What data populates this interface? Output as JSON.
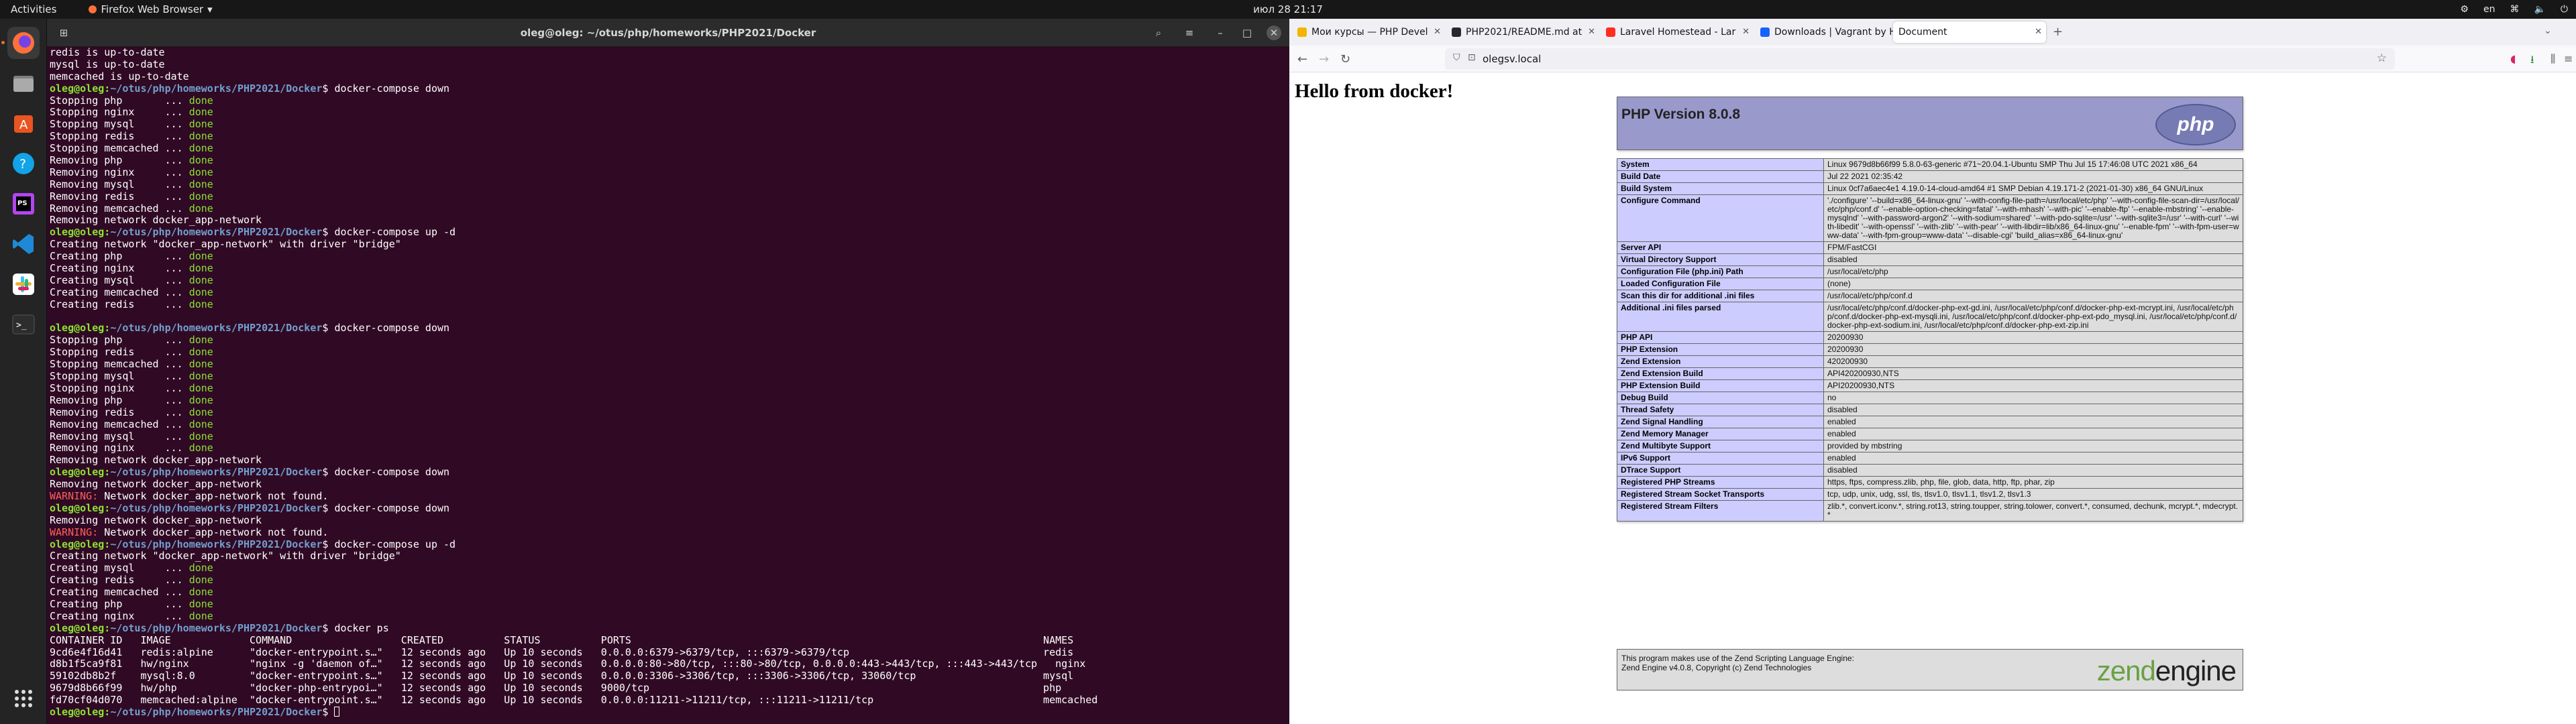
{
  "topbar": {
    "activities": "Activities",
    "app_name": "Firefox Web Browser",
    "clock": "июл 28  21:17",
    "lang": "en"
  },
  "dock": {
    "apps": [
      {
        "name": "firefox-icon",
        "color": "#ff7139",
        "active": true
      },
      {
        "name": "files-icon",
        "color": "#5e5e5e"
      },
      {
        "name": "software-icon",
        "color": "#e95420"
      },
      {
        "name": "help-icon",
        "color": "#12a3e8"
      },
      {
        "name": "phpstorm-icon",
        "color": "#b345f1"
      },
      {
        "name": "vscode-icon",
        "color": "#1e8ad6"
      },
      {
        "name": "slack-icon",
        "color": "#ffffff"
      },
      {
        "name": "terminal-icon",
        "color": "#2d2d2d"
      }
    ],
    "show_apps": "show-applications-icon"
  },
  "terminal": {
    "title": "oleg@oleg: ~/otus/php/homeworks/PHP2021/Docker",
    "prompt_user": "oleg@oleg",
    "prompt_path": "~/otus/php/homeworks/PHP2021/Docker",
    "lines": [
      {
        "t": "plain",
        "text": "redis is up-to-date"
      },
      {
        "t": "plain",
        "text": "mysql is up-to-date"
      },
      {
        "t": "plain",
        "text": "memcached is up-to-date"
      },
      {
        "t": "cmd",
        "text": "docker-compose down"
      },
      {
        "t": "status",
        "text": "Stopping php       ... ",
        "s": "done"
      },
      {
        "t": "status",
        "text": "Stopping nginx     ... ",
        "s": "done"
      },
      {
        "t": "status",
        "text": "Stopping mysql     ... ",
        "s": "done"
      },
      {
        "t": "status",
        "text": "Stopping redis     ... ",
        "s": "done"
      },
      {
        "t": "status",
        "text": "Stopping memcached ... ",
        "s": "done"
      },
      {
        "t": "status",
        "text": "Removing php       ... ",
        "s": "done"
      },
      {
        "t": "status",
        "text": "Removing nginx     ... ",
        "s": "done"
      },
      {
        "t": "status",
        "text": "Removing mysql     ... ",
        "s": "done"
      },
      {
        "t": "status",
        "text": "Removing redis     ... ",
        "s": "done"
      },
      {
        "t": "status",
        "text": "Removing memcached ... ",
        "s": "done"
      },
      {
        "t": "plain",
        "text": "Removing network docker_app-network"
      },
      {
        "t": "cmd",
        "text": "docker-compose up -d"
      },
      {
        "t": "plain",
        "text": "Creating network \"docker_app-network\" with driver \"bridge\""
      },
      {
        "t": "status",
        "text": "Creating php       ... ",
        "s": "done"
      },
      {
        "t": "status",
        "text": "Creating nginx     ... ",
        "s": "done"
      },
      {
        "t": "status",
        "text": "Creating mysql     ... ",
        "s": "done"
      },
      {
        "t": "status",
        "text": "Creating memcached ... ",
        "s": "done"
      },
      {
        "t": "status",
        "text": "Creating redis     ... ",
        "s": "done"
      },
      {
        "t": "blank",
        "text": ""
      },
      {
        "t": "cmd",
        "text": "docker-compose down"
      },
      {
        "t": "status",
        "text": "Stopping php       ... ",
        "s": "done"
      },
      {
        "t": "status",
        "text": "Stopping redis     ... ",
        "s": "done"
      },
      {
        "t": "status",
        "text": "Stopping memcached ... ",
        "s": "done"
      },
      {
        "t": "status",
        "text": "Stopping mysql     ... ",
        "s": "done"
      },
      {
        "t": "status",
        "text": "Stopping nginx     ... ",
        "s": "done"
      },
      {
        "t": "status",
        "text": "Removing php       ... ",
        "s": "done"
      },
      {
        "t": "status",
        "text": "Removing redis     ... ",
        "s": "done"
      },
      {
        "t": "status",
        "text": "Removing memcached ... ",
        "s": "done"
      },
      {
        "t": "status",
        "text": "Removing mysql     ... ",
        "s": "done"
      },
      {
        "t": "status",
        "text": "Removing nginx     ... ",
        "s": "done"
      },
      {
        "t": "plain",
        "text": "Removing network docker_app-network"
      },
      {
        "t": "cmd",
        "text": "docker-compose down"
      },
      {
        "t": "plain",
        "text": "Removing network docker_app-network"
      },
      {
        "t": "warn",
        "w": "WARNING:",
        "text": " Network docker_app-network not found."
      },
      {
        "t": "cmd",
        "text": "docker-compose down"
      },
      {
        "t": "plain",
        "text": "Removing network docker_app-network"
      },
      {
        "t": "warn",
        "w": "WARNING:",
        "text": " Network docker_app-network not found."
      },
      {
        "t": "cmd",
        "text": "docker-compose up -d"
      },
      {
        "t": "plain",
        "text": "Creating network \"docker_app-network\" with driver \"bridge\""
      },
      {
        "t": "status",
        "text": "Creating mysql     ... ",
        "s": "done"
      },
      {
        "t": "status",
        "text": "Creating redis     ... ",
        "s": "done"
      },
      {
        "t": "status",
        "text": "Creating memcached ... ",
        "s": "done"
      },
      {
        "t": "status",
        "text": "Creating php       ... ",
        "s": "done"
      },
      {
        "t": "status",
        "text": "Creating nginx     ... ",
        "s": "done"
      },
      {
        "t": "cmd",
        "text": "docker ps"
      },
      {
        "t": "plain",
        "text": "CONTAINER ID   IMAGE             COMMAND                  CREATED          STATUS          PORTS                                                                    NAMES"
      },
      {
        "t": "plain",
        "text": "9cd6e4f16d41   redis:alpine      \"docker-entrypoint.s…\"   12 seconds ago   Up 10 seconds   0.0.0.0:6379->6379/tcp, :::6379->6379/tcp                                redis"
      },
      {
        "t": "plain",
        "text": "d8b1f5ca9f81   hw/nginx          \"nginx -g 'daemon of…\"   12 seconds ago   Up 10 seconds   0.0.0.0:80->80/tcp, :::80->80/tcp, 0.0.0.0:443->443/tcp, :::443->443/tcp   nginx"
      },
      {
        "t": "plain",
        "text": "59102db8b2f    mysql:8.0         \"docker-entrypoint.s…\"   12 seconds ago   Up 10 seconds   0.0.0.0:3306->3306/tcp, :::3306->3306/tcp, 33060/tcp                     mysql"
      },
      {
        "t": "plain",
        "text": "9679d8b66f99   hw/php            \"docker-php-entrypoi…\"   12 seconds ago   Up 10 seconds   9000/tcp                                                                 php"
      },
      {
        "t": "plain",
        "text": "fd70cf04d070   memcached:alpine  \"docker-entrypoint.s…\"   12 seconds ago   Up 10 seconds   0.0.0.0:11211->11211/tcp, :::11211->11211/tcp                            memcached"
      },
      {
        "t": "cmdcur",
        "text": ""
      }
    ]
  },
  "browser": {
    "tabs": [
      {
        "label": "Мои курсы — PHP Devel",
        "color": "#f4b400"
      },
      {
        "label": "PHP2021/README.md at",
        "color": "#24292e"
      },
      {
        "label": "Laravel Homestead - Lar",
        "color": "#ff2d20"
      },
      {
        "label": "Downloads | Vagrant by H",
        "color": "#1563ff"
      },
      {
        "label": "Document",
        "color": "#dddddd",
        "active": true
      }
    ],
    "url": "olegsv.local",
    "page": {
      "heading": "Hello from docker!",
      "php_title": "PHP Version 8.0.8",
      "php_logo": "php",
      "rows": [
        [
          "System",
          "Linux 9679d8b66f99 5.8.0-63-generic #71~20.04.1-Ubuntu SMP Thu Jul 15 17:46:08 UTC 2021 x86_64"
        ],
        [
          "Build Date",
          "Jul 22 2021 02:35:42"
        ],
        [
          "Build System",
          "Linux 0cf7a6aec4e1 4.19.0-14-cloud-amd64 #1 SMP Debian 4.19.171-2 (2021-01-30) x86_64 GNU/Linux"
        ],
        [
          "Configure Command",
          "'./configure' '--build=x86_64-linux-gnu' '--with-config-file-path=/usr/local/etc/php' '--with-config-file-scan-dir=/usr/local/etc/php/conf.d' '--enable-option-checking=fatal' '--with-mhash' '--with-pic' '--enable-ftp' '--enable-mbstring' '--enable-mysqlnd' '--with-password-argon2' '--with-sodium=shared' '--with-pdo-sqlite=/usr' '--with-sqlite3=/usr' '--with-curl' '--with-libedit' '--with-openssl' '--with-zlib' '--with-pear' '--with-libdir=lib/x86_64-linux-gnu' '--enable-fpm' '--with-fpm-user=www-data' '--with-fpm-group=www-data' '--disable-cgi' 'build_alias=x86_64-linux-gnu'"
        ],
        [
          "Server API",
          "FPM/FastCGI"
        ],
        [
          "Virtual Directory Support",
          "disabled"
        ],
        [
          "Configuration File (php.ini) Path",
          "/usr/local/etc/php"
        ],
        [
          "Loaded Configuration File",
          "(none)"
        ],
        [
          "Scan this dir for additional .ini files",
          "/usr/local/etc/php/conf.d"
        ],
        [
          "Additional .ini files parsed",
          "/usr/local/etc/php/conf.d/docker-php-ext-gd.ini, /usr/local/etc/php/conf.d/docker-php-ext-mcrypt.ini, /usr/local/etc/php/conf.d/docker-php-ext-mysqli.ini, /usr/local/etc/php/conf.d/docker-php-ext-pdo_mysql.ini, /usr/local/etc/php/conf.d/docker-php-ext-sodium.ini, /usr/local/etc/php/conf.d/docker-php-ext-zip.ini"
        ],
        [
          "PHP API",
          "20200930"
        ],
        [
          "PHP Extension",
          "20200930"
        ],
        [
          "Zend Extension",
          "420200930"
        ],
        [
          "Zend Extension Build",
          "API420200930,NTS"
        ],
        [
          "PHP Extension Build",
          "API20200930,NTS"
        ],
        [
          "Debug Build",
          "no"
        ],
        [
          "Thread Safety",
          "disabled"
        ],
        [
          "Zend Signal Handling",
          "enabled"
        ],
        [
          "Zend Memory Manager",
          "enabled"
        ],
        [
          "Zend Multibyte Support",
          "provided by mbstring"
        ],
        [
          "IPv6 Support",
          "enabled"
        ],
        [
          "DTrace Support",
          "disabled"
        ],
        [
          "Registered PHP Streams",
          "https, ftps, compress.zlib, php, file, glob, data, http, ftp, phar, zip"
        ],
        [
          "Registered Stream Socket Transports",
          "tcp, udp, unix, udg, ssl, tls, tlsv1.0, tlsv1.1, tlsv1.2, tlsv1.3"
        ],
        [
          "Registered Stream Filters",
          "zlib.*, convert.iconv.*, string.rot13, string.toupper, string.tolower, convert.*, consumed, dechunk, mcrypt.*, mdecrypt.*"
        ]
      ],
      "zend_line1": "This program makes use of the Zend Scripting Language Engine:",
      "zend_line2": "Zend Engine v4.0.8, Copyright (c) Zend Technologies",
      "zend_logo_a": "zend",
      "zend_logo_b": "engine"
    }
  }
}
